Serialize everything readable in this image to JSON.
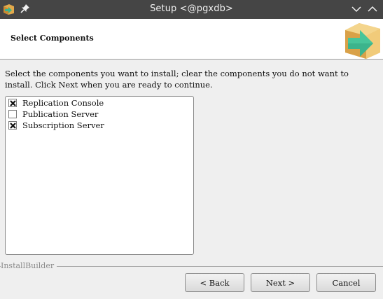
{
  "window": {
    "title": "Setup <@pgxdb>",
    "app_icon": "package-installer-icon",
    "pin_icon": "pin-icon",
    "minimize_icon": "chevron-down-icon",
    "maximize_icon": "chevron-up-icon"
  },
  "header": {
    "section_title": "Select Components",
    "logo_icon": "package-arrow-icon"
  },
  "description": "Select the components you want to install; clear the components you do not want to install. Click Next when you are ready to continue.",
  "components": [
    {
      "label": "Replication Console",
      "checked": true
    },
    {
      "label": "Publication Server",
      "checked": false
    },
    {
      "label": "Subscription Server",
      "checked": true
    }
  ],
  "footer": {
    "builder_label": "InstallBuilder",
    "back_label": "< Back",
    "next_label": "Next >",
    "cancel_label": "Cancel"
  },
  "colors": {
    "titlebar": "#454545",
    "header_bg": "#ffffff",
    "dialog_bg": "#efefef",
    "logo_box": "#e8b85a",
    "logo_arrow": "#3cb48c"
  }
}
